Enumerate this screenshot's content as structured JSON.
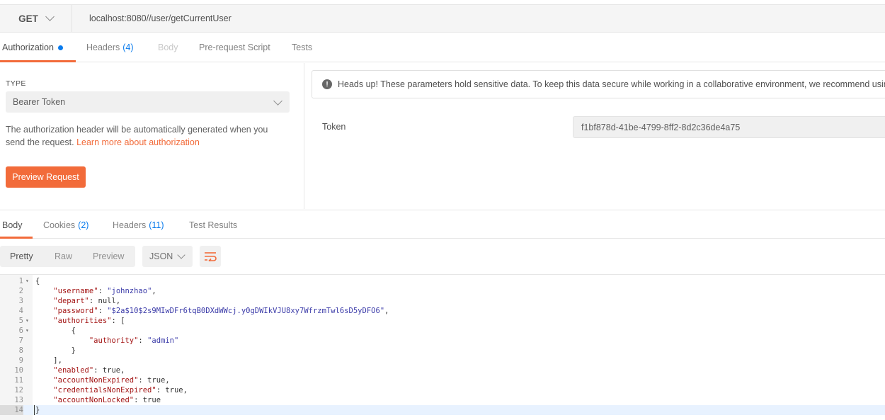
{
  "request": {
    "method": "GET",
    "url": "localhost:8080//user/getCurrentUser"
  },
  "request_tabs": [
    {
      "label": "Authorization",
      "count": "",
      "state": "active",
      "indicator": true
    },
    {
      "label": "Headers",
      "count": "(4)",
      "state": "normal"
    },
    {
      "label": "Body",
      "count": "",
      "state": "disabled"
    },
    {
      "label": "Pre-request Script",
      "count": "",
      "state": "normal"
    },
    {
      "label": "Tests",
      "count": "",
      "state": "normal"
    }
  ],
  "auth": {
    "type_label": "TYPE",
    "type_value": "Bearer Token",
    "description": "The authorization header will be automatically generated when you send the request. ",
    "learn_more": "Learn more about authorization",
    "preview_button": "Preview Request",
    "notice": "Heads up! These parameters hold sensitive data. To keep this data secure while working in a collaborative environment, we recommend using variables.",
    "token_label": "Token",
    "token_value": "f1bf878d-41be-4799-8ff2-8d2c36de4a75"
  },
  "response_tabs": [
    {
      "label": "Body",
      "count": "",
      "state": "active"
    },
    {
      "label": "Cookies",
      "count": "(2)",
      "state": "normal"
    },
    {
      "label": "Headers",
      "count": "(11)",
      "state": "normal"
    },
    {
      "label": "Test Results",
      "count": "",
      "state": "normal"
    }
  ],
  "format": {
    "options": [
      "Pretty",
      "Raw",
      "Preview"
    ],
    "selected": "Pretty",
    "language": "JSON",
    "wrap_icon": "wrap-lines-icon"
  },
  "editor": {
    "current_line": 14,
    "lines": [
      {
        "n": "1",
        "fold": true,
        "text": "{"
      },
      {
        "n": "2",
        "fold": false,
        "text": "    \"username\": \"johnzhao\","
      },
      {
        "n": "3",
        "fold": false,
        "text": "    \"depart\": null,"
      },
      {
        "n": "4",
        "fold": false,
        "text": "    \"password\": \"$2a$10$2s9MIwDFr6tqB0DXdWWcj.y0gDWIkVJU8xy7WfrzmTwl6sD5yDFO6\","
      },
      {
        "n": "5",
        "fold": true,
        "text": "    \"authorities\": ["
      },
      {
        "n": "6",
        "fold": true,
        "text": "        {"
      },
      {
        "n": "7",
        "fold": false,
        "text": "            \"authority\": \"admin\""
      },
      {
        "n": "8",
        "fold": false,
        "text": "        }"
      },
      {
        "n": "9",
        "fold": false,
        "text": "    ],"
      },
      {
        "n": "10",
        "fold": false,
        "text": "    \"enabled\": true,"
      },
      {
        "n": "11",
        "fold": false,
        "text": "    \"accountNonExpired\": true,"
      },
      {
        "n": "12",
        "fold": false,
        "text": "    \"credentialsNonExpired\": true,"
      },
      {
        "n": "13",
        "fold": false,
        "text": "    \"accountNonLocked\": true"
      },
      {
        "n": "14",
        "fold": false,
        "text": "}"
      }
    ]
  },
  "colors": {
    "accent": "#f26b3a",
    "link_blue": "#097bed"
  }
}
